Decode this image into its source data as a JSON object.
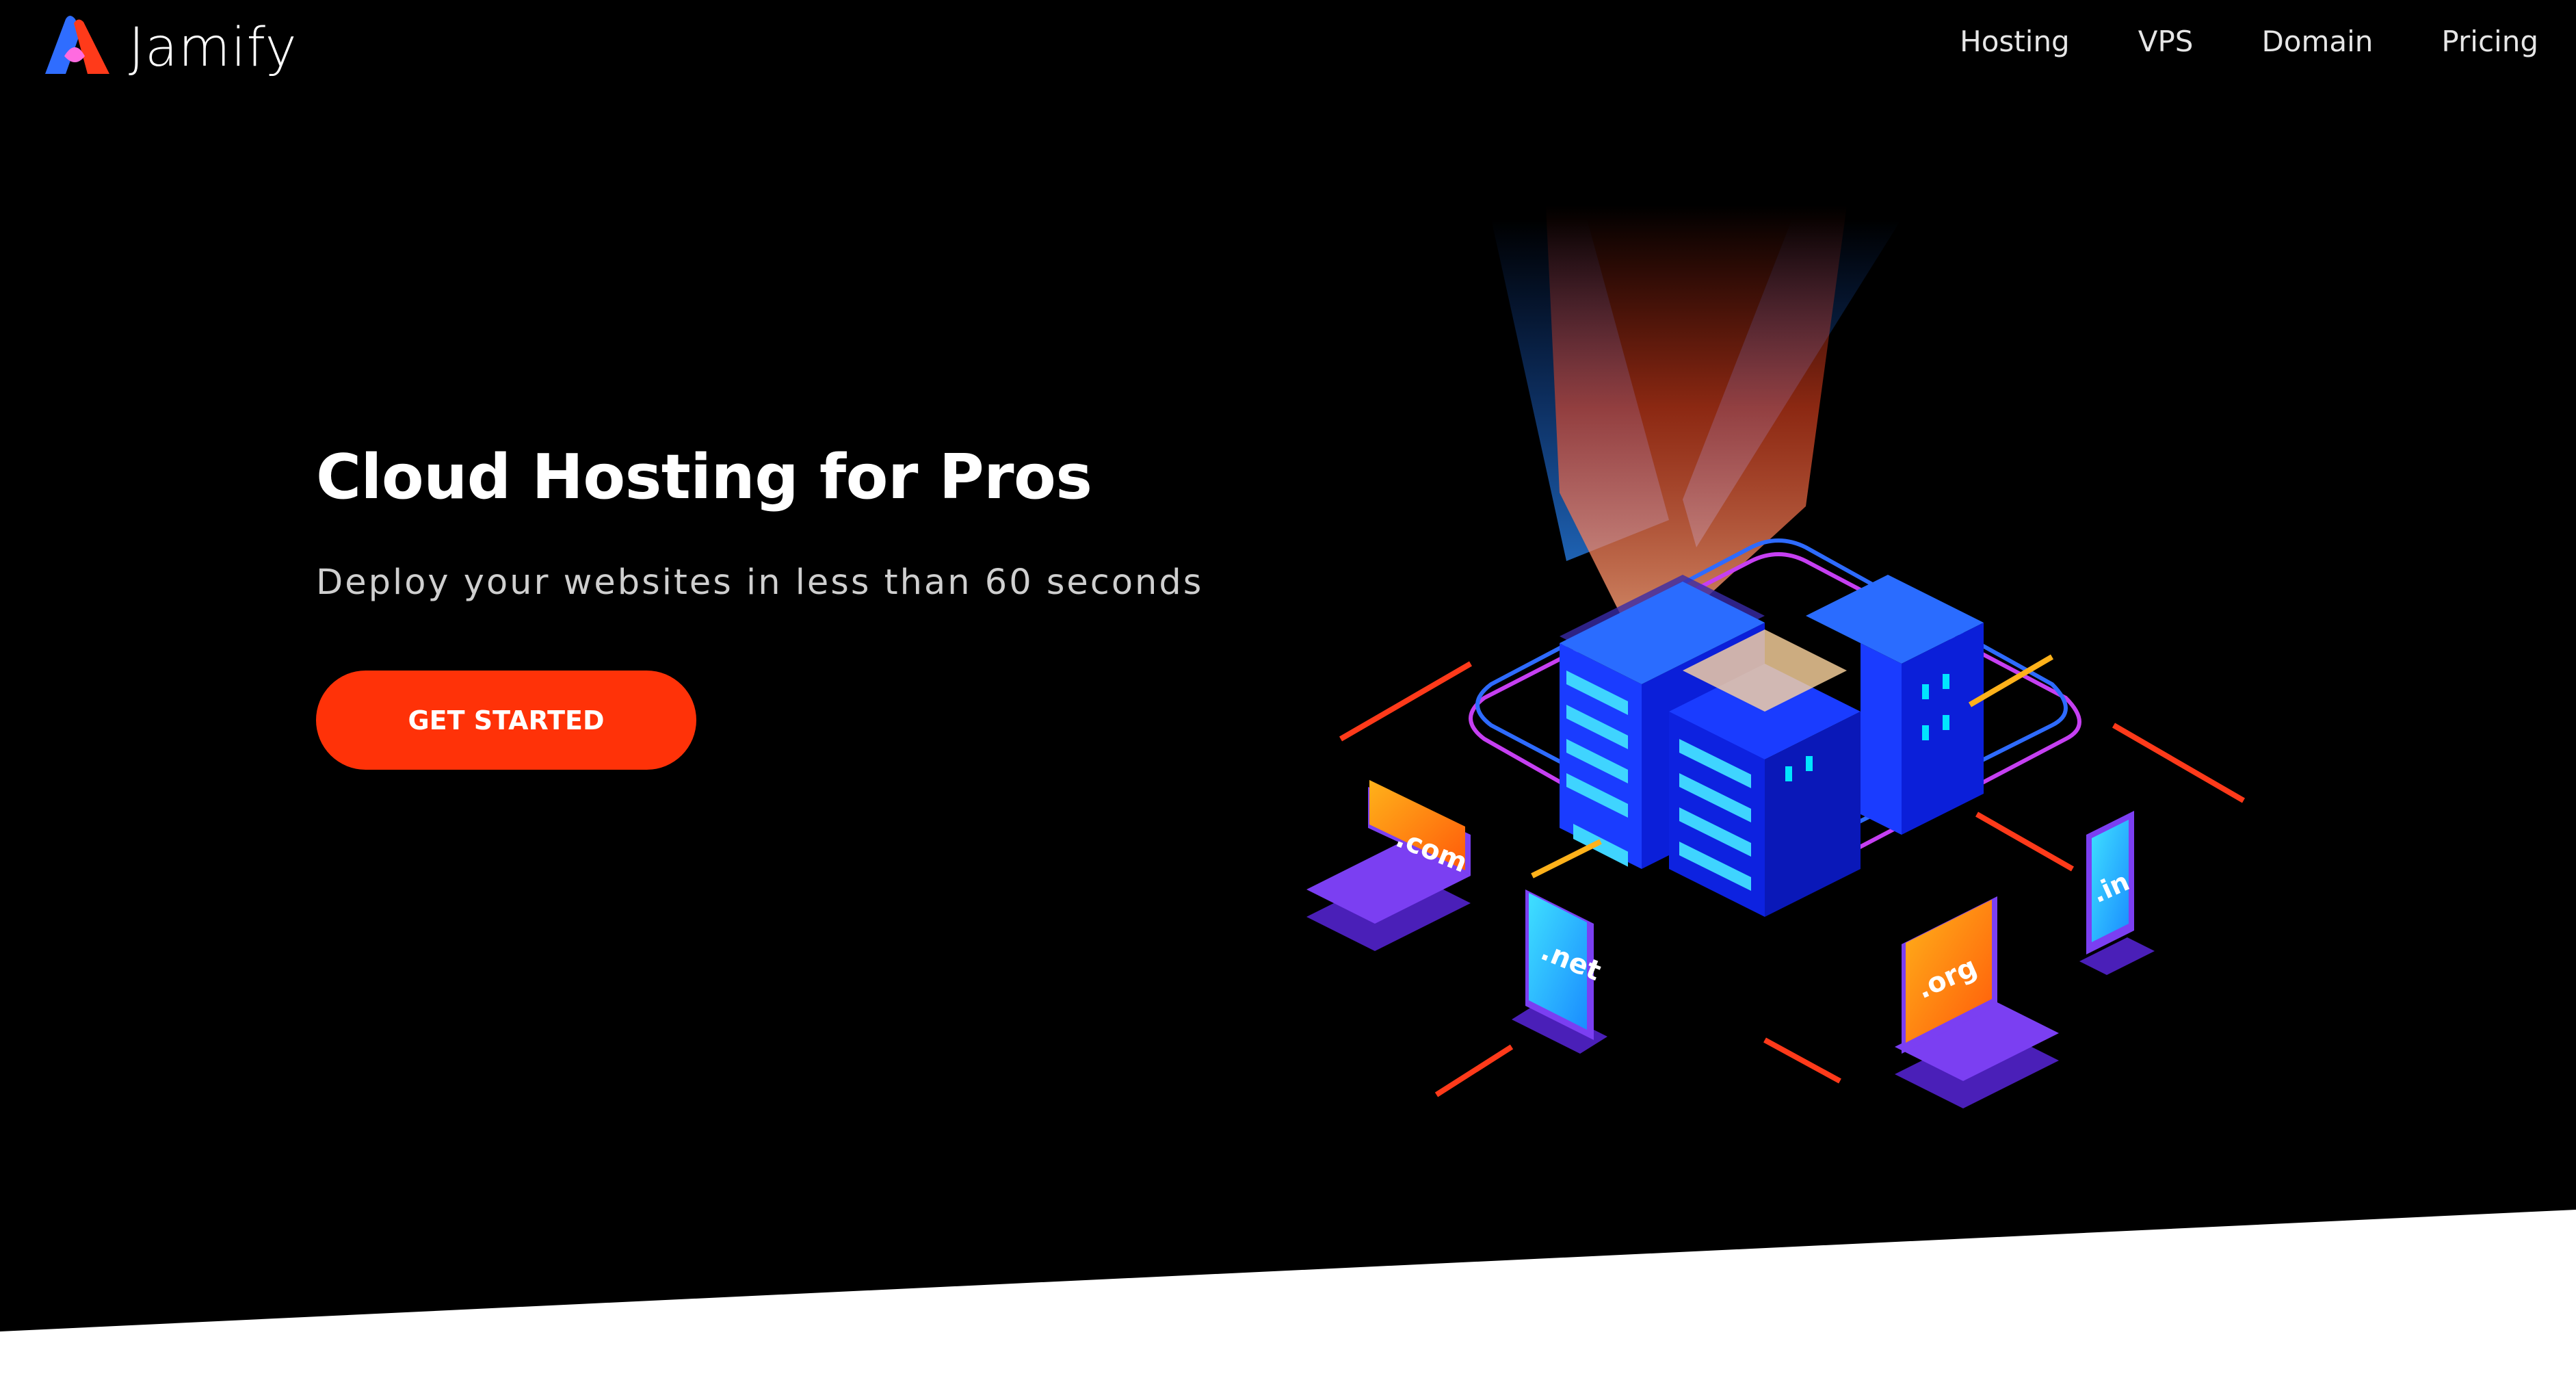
{
  "header": {
    "brand": "Jamify",
    "logo_icon": "jamify-logo-icon",
    "nav": [
      {
        "label": "Hosting"
      },
      {
        "label": "VPS"
      },
      {
        "label": "Domain"
      },
      {
        "label": "Pricing"
      }
    ]
  },
  "hero": {
    "title": "Cloud Hosting for Pros",
    "subtitle": "Deploy your websites in less than 60 seconds",
    "cta": "GET STARTED"
  },
  "illustration": {
    "name": "isometric-server-illustration",
    "domains": [
      ".com",
      ".net",
      ".org",
      ".in"
    ]
  },
  "colors": {
    "background": "#000000",
    "accent": "#ff3208",
    "text": "#ffffff",
    "subtext": "#cfcfcf",
    "server_blue": "#1a3cff",
    "device_purple": "#7b3ff2"
  }
}
